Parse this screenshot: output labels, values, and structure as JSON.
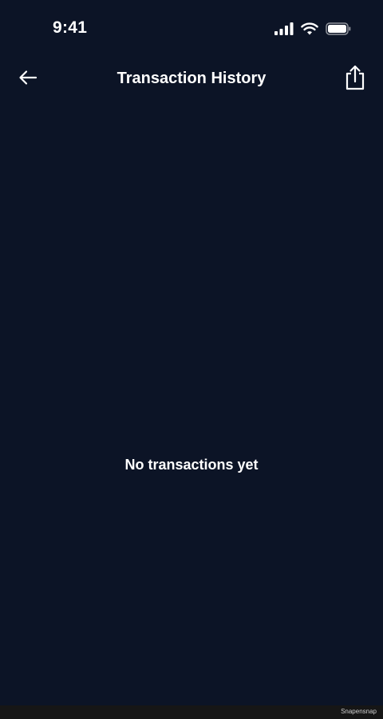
{
  "status_bar": {
    "time": "9:41",
    "icons": [
      "cellular-signal-icon",
      "wifi-icon",
      "battery-icon"
    ]
  },
  "nav": {
    "title": "Transaction History",
    "back_icon": "arrow-left-icon",
    "share_icon": "share-icon"
  },
  "empty_state": {
    "message": "No transactions yet"
  },
  "footer": {
    "watermark": "Snapensnap"
  },
  "colors": {
    "background": "#0c1426",
    "text": "#ffffff",
    "bottom_strip": "#161616"
  }
}
